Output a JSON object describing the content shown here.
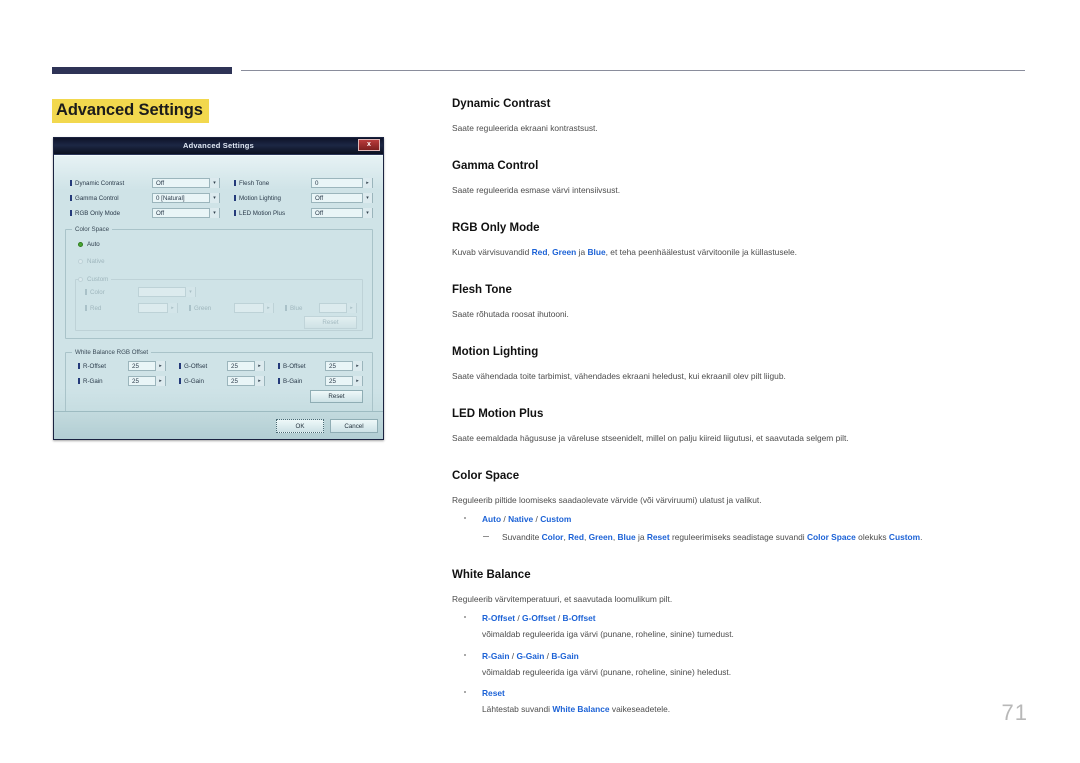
{
  "page": {
    "title": "Advanced Settings",
    "number": "71",
    "accent_highlight": "#f2d84e",
    "link_color": "#1c62d6",
    "rule_color": "#2e3356"
  },
  "dialog": {
    "title": "Advanced Settings",
    "close_label": "x",
    "rows": [
      {
        "label": "Dynamic Contrast",
        "value": "Off"
      },
      {
        "label": "Gamma Control",
        "value": "0 [Natural]"
      },
      {
        "label": "RGB Only Mode",
        "value": "Off"
      }
    ],
    "rows_right": [
      {
        "label": "Flesh Tone",
        "value": "0"
      },
      {
        "label": "Motion Lighting",
        "value": "Off"
      },
      {
        "label": "LED Motion Plus",
        "value": "Off"
      }
    ],
    "color_space": {
      "group_title": "Color Space",
      "options": [
        {
          "label": "Auto",
          "selected": true
        },
        {
          "label": "Native",
          "selected": false
        },
        {
          "label": "Custom",
          "selected": false
        }
      ],
      "custom": {
        "color_label": "Color",
        "color_value": "",
        "red_label": "Red",
        "red_value": "",
        "green_label": "Green",
        "green_value": "",
        "blue_label": "Blue",
        "blue_value": "",
        "reset_label": "Reset"
      }
    },
    "white_balance": {
      "group_title": "White Balance RGB Offset",
      "fields": [
        {
          "label": "R-Offset",
          "value": "25"
        },
        {
          "label": "G-Offset",
          "value": "25"
        },
        {
          "label": "B-Offset",
          "value": "25"
        },
        {
          "label": "R-Gain",
          "value": "25"
        },
        {
          "label": "G-Gain",
          "value": "25"
        },
        {
          "label": "B-Gain",
          "value": "25"
        }
      ],
      "reset_label": "Reset"
    },
    "ok_label": "OK",
    "cancel_label": "Cancel"
  },
  "sections": {
    "dynamic_contrast": {
      "heading": "Dynamic Contrast",
      "body": "Saate reguleerida ekraani kontrastsust."
    },
    "gamma_control": {
      "heading": "Gamma Control",
      "body": "Saate reguleerida esmase värvi intensiivsust."
    },
    "rgb_only_mode": {
      "heading": "RGB Only Mode",
      "body_1": "Kuvab värvisuvandid ",
      "red": "Red",
      "comma_1": ", ",
      "green": "Green",
      "ja_1": " ja ",
      "blue": "Blue",
      "body_2": ", et teha peenhäälestust värvitoonile ja küllastusele."
    },
    "flesh_tone": {
      "heading": "Flesh Tone",
      "body": "Saate rõhutada roosat ihutooni."
    },
    "motion_lighting": {
      "heading": "Motion Lighting",
      "body": "Saate vähendada toite tarbimist, vähendades ekraani heledust, kui ekraanil olev pilt liigub."
    },
    "led_motion_plus": {
      "heading": "LED Motion Plus",
      "body": "Saate eemaldada hägususe ja väreluse stseenidelt, millel on palju kiireid liigutusi, et saavutada selgem pilt."
    },
    "color_space": {
      "heading": "Color Space",
      "body": "Reguleerib piltide loomiseks saadaolevate värvide (või värviruumi) ulatust ja valikut.",
      "bullet_auto": "Auto",
      "bullet_native": "Native",
      "bullet_custom": "Custom",
      "sub_1": "Suvandite ",
      "sub_color": "Color",
      "sub_c1": ", ",
      "sub_red": "Red",
      "sub_c2": ", ",
      "sub_green": "Green",
      "sub_c3": ", ",
      "sub_blue": "Blue",
      "sub_ja": " ja ",
      "sub_reset": "Reset",
      "sub_2": " reguleerimiseks seadistage suvandi ",
      "sub_colorspace": "Color Space",
      "sub_3": " olekuks ",
      "sub_custom": "Custom",
      "sub_4": "."
    },
    "white_balance": {
      "heading": "White Balance",
      "body": "Reguleerib värvitemperatuuri, et saavutada loomulikum pilt.",
      "b1_r": "R-Offset",
      "b1_g": "G-Offset",
      "b1_b": "B-Offset",
      "b1_text": "võimaldab reguleerida iga värvi (punane, roheline, sinine) tumedust.",
      "b2_r": "R-Gain",
      "b2_g": "G-Gain",
      "b2_b": "B-Gain",
      "b2_text": "võimaldab reguleerida iga värvi (punane, roheline, sinine) heledust.",
      "b3_reset": "Reset",
      "b3_text_1": "Lähtestab suvandi ",
      "b3_wb": "White Balance",
      "b3_text_2": " vaikeseadetele."
    }
  }
}
